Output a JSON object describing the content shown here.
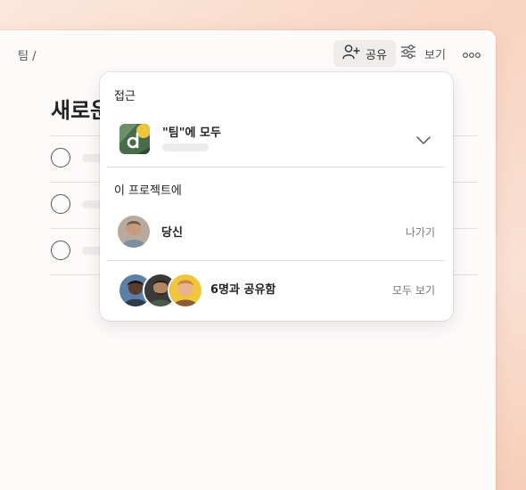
{
  "breadcrumb": {
    "team": "팀 /"
  },
  "toolbar": {
    "share_label": "공유",
    "view_label": "보기"
  },
  "page": {
    "title": "새로운"
  },
  "popover": {
    "access_heading": "접근",
    "access_name": "\"팀\"에 모두",
    "project_heading": "이 프로젝트에",
    "me": {
      "name": "당신",
      "action": "나가기"
    },
    "shared": {
      "label": "6명과 공유함",
      "action": "모두 보기"
    }
  },
  "colors": {
    "accent_gradient_start": "#fbe8dc",
    "accent_gradient_end": "#f6cdb7",
    "logo_green": "#4a6b4a",
    "logo_yellow": "#f0c43a"
  },
  "icons": {
    "share": "person-add-icon",
    "view": "sliders-icon",
    "more": "more-horizontal-icon",
    "chevron": "chevron-down-icon"
  }
}
